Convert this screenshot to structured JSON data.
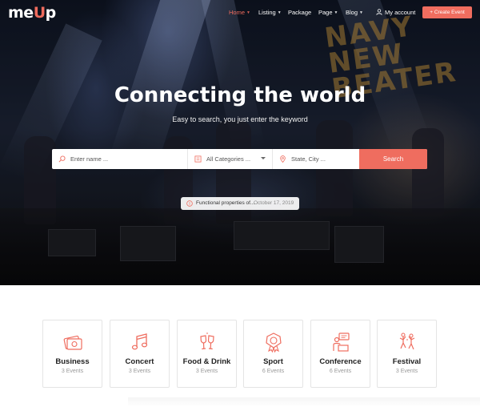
{
  "brand": {
    "logo_prefix": "me",
    "logo_accent": "U",
    "logo_suffix": "p",
    "accent_color": "#ef6d5f"
  },
  "nav": {
    "items": [
      {
        "label": "Home",
        "active": true,
        "dropdown": true
      },
      {
        "label": "Listing",
        "active": false,
        "dropdown": true
      },
      {
        "label": "Package",
        "active": false,
        "dropdown": false
      },
      {
        "label": "Page",
        "active": false,
        "dropdown": true
      },
      {
        "label": "Blog",
        "active": false,
        "dropdown": true
      }
    ],
    "account_label": "My account",
    "create_button": "+ Create Event"
  },
  "hero": {
    "title": "Connecting the world",
    "subtitle": "Easy to search, you just enter the keyword",
    "backdrop_sign": "NAVY NEW BEATER"
  },
  "search": {
    "name_placeholder": "Enter name ...",
    "category_value": "All Categories ...",
    "location_placeholder": "State, City ...",
    "button_label": "Search"
  },
  "announcement": {
    "title": "Functional properties of...",
    "date": "October 17, 2019"
  },
  "categories": [
    {
      "name": "Business",
      "count": "3 Events",
      "icon": "money-icon"
    },
    {
      "name": "Concert",
      "count": "3 Events",
      "icon": "music-note-icon"
    },
    {
      "name": "Food & Drink",
      "count": "3 Events",
      "icon": "cheers-glasses-icon"
    },
    {
      "name": "Sport",
      "count": "6 Events",
      "icon": "medal-icon"
    },
    {
      "name": "Conference",
      "count": "6 Events",
      "icon": "presentation-icon"
    },
    {
      "name": "Festival",
      "count": "3 Events",
      "icon": "dancers-icon"
    }
  ]
}
